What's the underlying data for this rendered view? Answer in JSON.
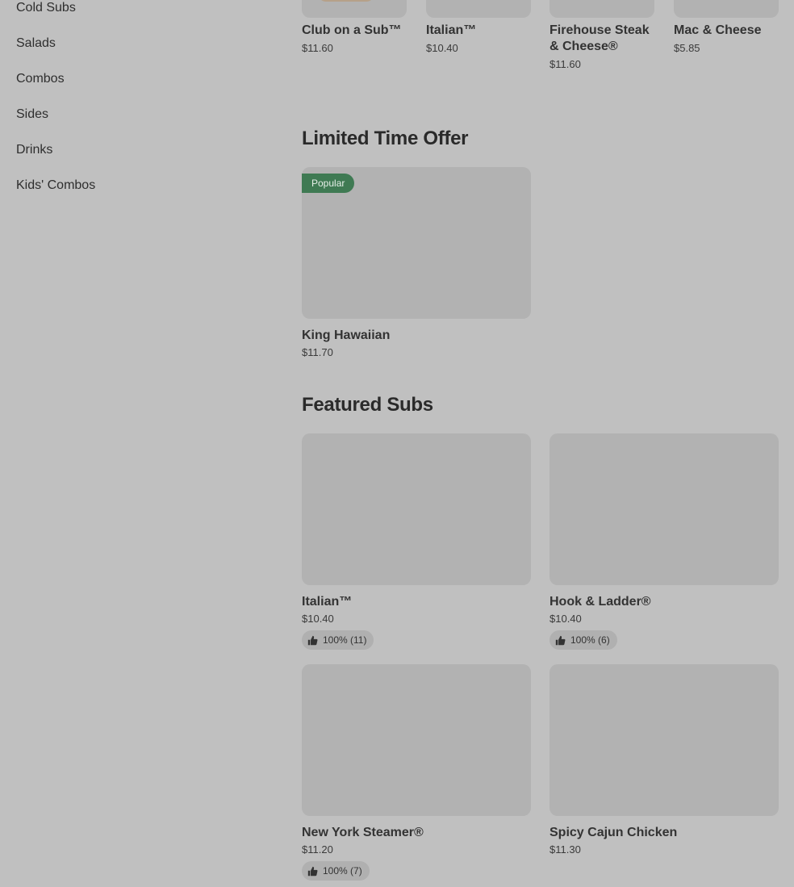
{
  "sidebar": {
    "items": [
      {
        "label": "Cold Subs"
      },
      {
        "label": "Salads"
      },
      {
        "label": "Combos"
      },
      {
        "label": "Sides"
      },
      {
        "label": "Drinks"
      },
      {
        "label": "Kids' Combos"
      }
    ]
  },
  "top_row": [
    {
      "name": "Club on a Sub™",
      "price": "$11.60"
    },
    {
      "name": "Italian™",
      "price": "$10.40"
    },
    {
      "name": "Firehouse Steak & Cheese®",
      "price": "$11.60"
    },
    {
      "name": "Mac & Cheese",
      "price": "$5.85"
    }
  ],
  "limited": {
    "title": "Limited Time Offer",
    "items": [
      {
        "badge": "Popular",
        "name": "King Hawaiian",
        "price": "$11.70"
      }
    ]
  },
  "featured": {
    "title": "Featured Subs",
    "items": [
      {
        "name": "Italian™",
        "price": "$10.40",
        "rating": "100% (11)"
      },
      {
        "name": "Hook & Ladder®",
        "price": "$10.40",
        "rating": "100% (6)"
      },
      {
        "name": "New York Steamer®",
        "price": "$11.20",
        "rating": "100% (7)"
      },
      {
        "name": "Spicy Cajun Chicken",
        "price": "$11.30",
        "rating": ""
      }
    ]
  },
  "icons": {
    "rating": "thumbs-up-icon"
  },
  "colors": {
    "background": "#c0c0c0",
    "badge": "#3f7a53",
    "placeholder": "#b2b2b2"
  }
}
